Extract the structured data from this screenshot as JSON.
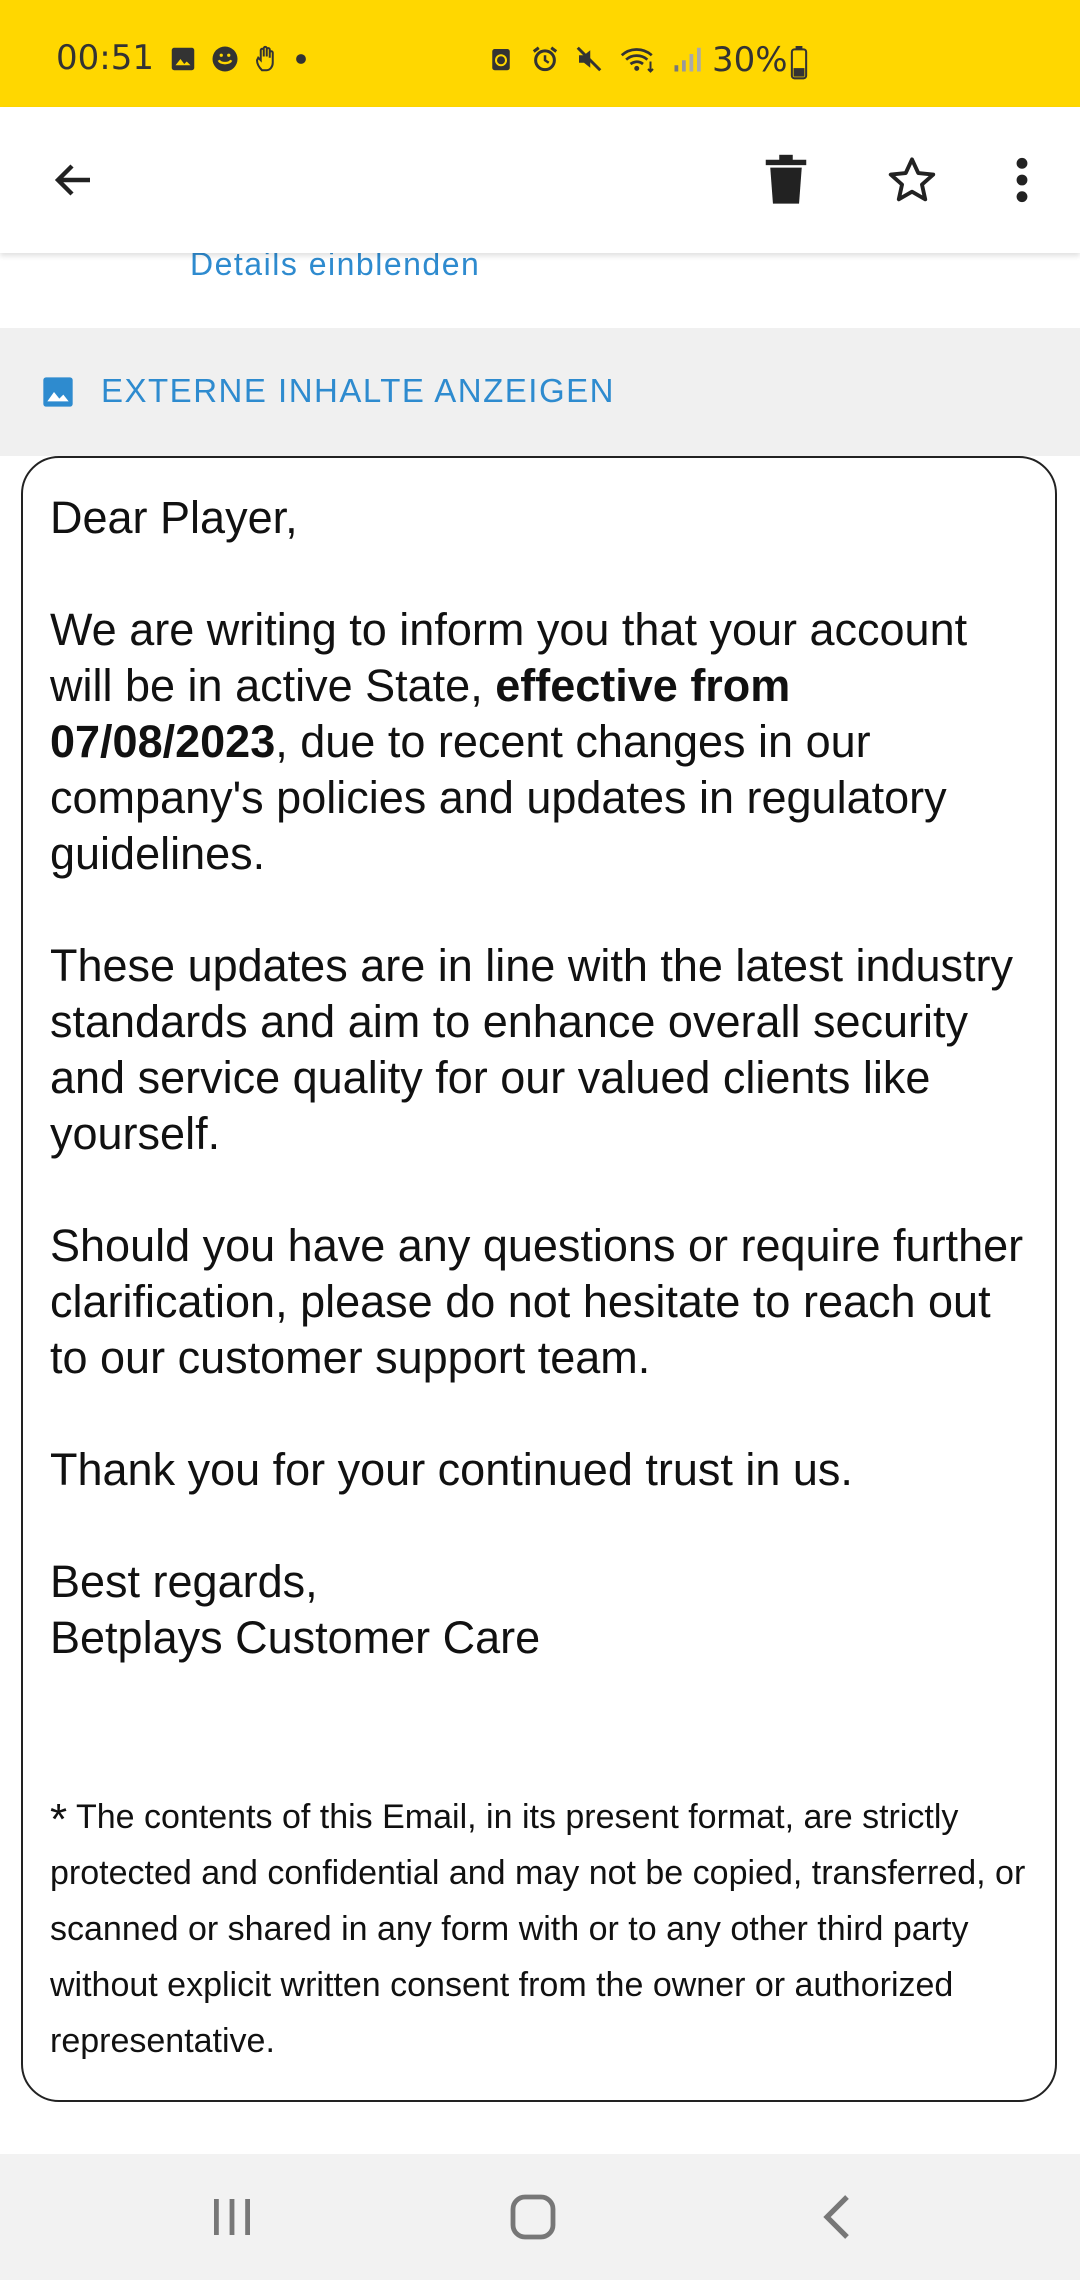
{
  "status_bar": {
    "time": "00:51",
    "battery": "30%",
    "background_color": "#FFD700",
    "icons_left": [
      "gallery-icon",
      "face-icon",
      "hand-icon",
      "dot-icon"
    ],
    "icons_right": [
      "sync-icon",
      "alarm-icon",
      "mute-icon",
      "wifi-icon",
      "signal-icon",
      "battery-icon"
    ]
  },
  "app_bar": {
    "icons": [
      "back-arrow-icon",
      "trash-icon",
      "star-icon",
      "more-vert-icon"
    ]
  },
  "header": {
    "details_link": "Details einblenden"
  },
  "external_content": {
    "label": "EXTERNE INHALTE ANZEIGEN",
    "icon": "image-icon",
    "accent_color": "#2e8bcf"
  },
  "email": {
    "greeting": "Dear Player,",
    "p1_before": "We are writing to inform you that your account will be in active State, ",
    "p1_bold": "effective from 07/08/2023",
    "p1_after": ", due to recent changes in our company's policies and updates in regulatory guidelines.",
    "p2": "These updates are in line with the latest industry standards and aim to enhance overall security and service quality for our valued clients like yourself.",
    "p3": "Should you have any questions or require further clarification, please do not hesitate to reach out to our customer support team.",
    "p4": "Thank you for your continued trust in us.",
    "closing": "Best regards,",
    "signature": "Betplays Customer Care",
    "disclaimer_star": "*",
    "disclaimer": " The contents of this Email, in its present format, are strictly protected and confidential and may not be copied, transferred, or scanned or shared in any form with or to any other third party without explicit written consent from the owner or authorized representative."
  },
  "nav_bar": {
    "icons": [
      "recents-icon",
      "home-icon",
      "back-icon"
    ]
  }
}
